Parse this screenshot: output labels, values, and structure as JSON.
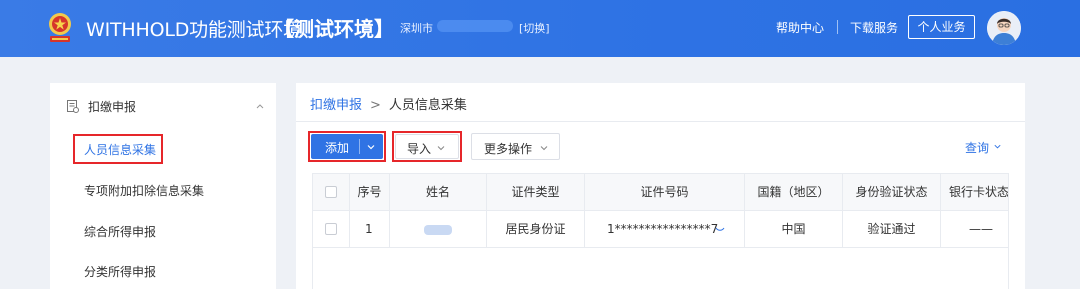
{
  "header": {
    "app_title": "WITHHOLD功能测试环境",
    "env_tag": "【测试环境】",
    "city": "深圳市",
    "switch_label": "[切换]",
    "help": "帮助中心",
    "download": "下载服务",
    "personal": "个人业务"
  },
  "sidebar": {
    "group_label": "扣缴申报",
    "items": [
      {
        "label": "人员信息采集",
        "active": true
      },
      {
        "label": "专项附加扣除信息采集"
      },
      {
        "label": "综合所得申报"
      },
      {
        "label": "分类所得申报"
      }
    ]
  },
  "breadcrumb": {
    "parent": "扣缴申报",
    "separator": ">",
    "current": "人员信息采集"
  },
  "toolbar": {
    "add": "添加",
    "import": "导入",
    "more": "更多操作",
    "query": "查询"
  },
  "table": {
    "headers": {
      "seq": "序号",
      "name": "姓名",
      "id_type": "证件类型",
      "id_number": "证件号码",
      "nationality": "国籍（地区）",
      "verify_status": "身份验证状态",
      "bank_status": "银行卡状态"
    },
    "rows": [
      {
        "seq": "1",
        "id_type": "居民身份证",
        "id_number": "1****************7",
        "nationality": "中国",
        "verify_status": "验证通过",
        "bank_status": "——"
      }
    ]
  },
  "colors": {
    "primary": "#2f73e4",
    "highlight_box": "#e6262a",
    "header_bg": "#2f73e4",
    "page_bg": "#eef1f6"
  }
}
